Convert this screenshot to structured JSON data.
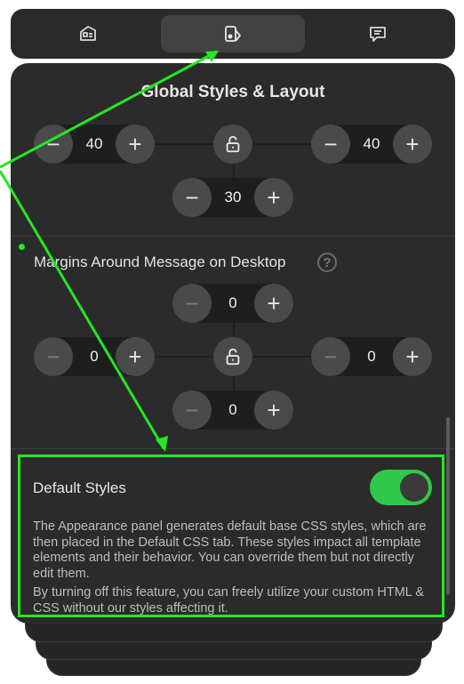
{
  "tabs": [
    {
      "icon": "layout-card-icon",
      "active": false
    },
    {
      "icon": "paint-bucket-icon",
      "active": true
    },
    {
      "icon": "message-square-icon",
      "active": false
    }
  ],
  "panel": {
    "title": "Global Styles & Layout"
  },
  "padding": {
    "left": "40",
    "right": "40",
    "bottom": "30"
  },
  "margins": {
    "label": "Margins Around Message on Desktop",
    "help": "?",
    "top": "0",
    "left": "0",
    "right": "0",
    "bottom": "0"
  },
  "stepper": {
    "minus": "−",
    "plus": "+"
  },
  "default_styles": {
    "title": "Default Styles",
    "enabled": true,
    "description_1": "The Appearance panel generates default base CSS styles, which are then placed in the Default CSS tab. These styles impact all template elements and their behavior. You can override them but not directly edit them.",
    "description_2": "By turning off this feature, you can freely utilize your custom HTML & CSS without our styles affecting it."
  },
  "colors": {
    "highlight": "#22e822",
    "toggle_on": "#30c94a",
    "panel_bg": "#2b2b2b"
  }
}
